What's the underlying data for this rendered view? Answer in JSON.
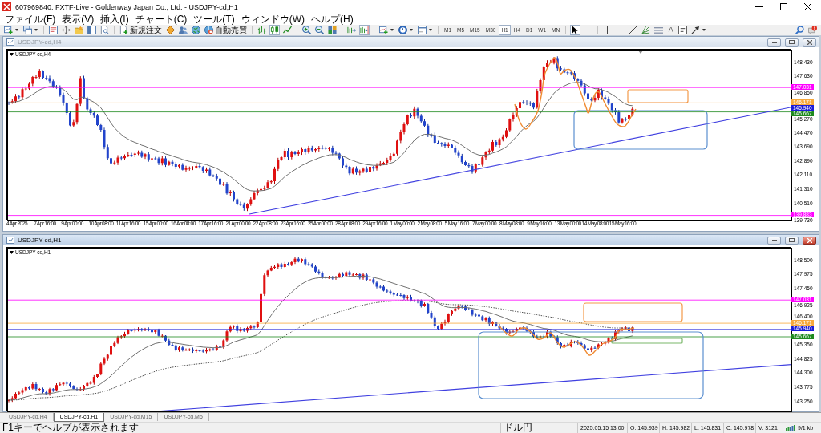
{
  "window": {
    "title": "607969840: FXTF-Live - Goldenway Japan Co., Ltd. - USDJPY-cd,H1"
  },
  "menu": [
    "ファイル(F)",
    "表示(V)",
    "挿入(I)",
    "チャート(C)",
    "ツール(T)",
    "ウィンドウ(W)",
    "ヘルプ(H)"
  ],
  "toolbar": {
    "new_order": "新規注文",
    "auto_trading": "自動売買",
    "chart_types": [
      {
        "kind": "bar",
        "selected": false
      },
      {
        "kind": "candle",
        "selected": true
      },
      {
        "kind": "line",
        "selected": false
      }
    ],
    "scroll": [
      {
        "kind": "shift",
        "on": false
      },
      {
        "kind": "autoscroll",
        "on": true
      }
    ],
    "timeframes": [
      {
        "label": "M1",
        "selected": false
      },
      {
        "label": "M5",
        "selected": false
      },
      {
        "label": "M15",
        "selected": false
      },
      {
        "label": "M30",
        "selected": false
      },
      {
        "label": "H1",
        "selected": true
      },
      {
        "label": "H4",
        "selected": false
      },
      {
        "label": "D1",
        "selected": false
      },
      {
        "label": "W1",
        "selected": false
      },
      {
        "label": "MN",
        "selected": false
      }
    ],
    "tools": [
      {
        "kind": "cursor",
        "selected": true
      },
      {
        "kind": "crosshair",
        "selected": false
      },
      {
        "kind": "vline",
        "selected": false
      },
      {
        "kind": "hline",
        "selected": false
      },
      {
        "kind": "trendline",
        "selected": false
      },
      {
        "kind": "fan",
        "selected": false
      },
      {
        "kind": "channel",
        "selected": false
      },
      {
        "kind": "text",
        "label": "A",
        "selected": false
      },
      {
        "kind": "label",
        "selected": false
      },
      {
        "kind": "arrows",
        "selected": false
      }
    ]
  },
  "charts": [
    {
      "title": "USDJPY-cd,H4",
      "active": false,
      "label": "USDJPY-cd,H4",
      "price_ticks": [
        "148.430",
        "147.630",
        "146.850",
        "145.270",
        "144.470",
        "143.690",
        "142.890",
        "142.110",
        "141.310",
        "140.510",
        "139.730"
      ],
      "price_tags": [
        {
          "text": "147.031",
          "color": "#ff00ff"
        },
        {
          "text": "146.171",
          "color": "#f7a83a"
        },
        {
          "text": "145.940",
          "color": "#1c1cd8"
        },
        {
          "text": "145.667",
          "color": "#1e8a1e"
        },
        {
          "text": "139.883",
          "color": "#ff00ff"
        }
      ],
      "time_ticks": [
        "4 Apr 2025",
        "7 Apr 16:00",
        "9 Apr 00:00",
        "10 Apr 08:00",
        "11 Apr 16:00",
        "15 Apr 00:00",
        "16 Apr 08:00",
        "17 Apr 16:00",
        "21 Apr 00:00",
        "22 Apr 08:00",
        "23 Apr 16:00",
        "25 Apr 00:00",
        "28 Apr 08:00",
        "29 Apr 16:00",
        "1 May 00:00",
        "2 May 08:00",
        "5 May 16:00",
        "7 May 00:00",
        "8 May 08:00",
        "9 May 16:00",
        "13 May 00:00",
        "14 May 08:00",
        "15 May 16:00"
      ]
    },
    {
      "title": "USDJPY-cd,H1",
      "active": true,
      "label": "USDJPY-cd,H1",
      "price_ticks": [
        "148.500",
        "147.975",
        "147.450",
        "146.925",
        "146.400",
        "145.350",
        "144.825",
        "144.300",
        "143.775",
        "143.250"
      ],
      "price_tags": [
        {
          "text": "147.031",
          "color": "#ff00ff"
        },
        {
          "text": "146.171",
          "color": "#f7a83a"
        },
        {
          "text": "145.940",
          "color": "#1c1cd8"
        },
        {
          "text": "145.667",
          "color": "#1e8a1e"
        }
      ]
    }
  ],
  "tabs": [
    {
      "label": "USDJPY-cd,H4",
      "selected": false
    },
    {
      "label": "USDJPY-cd,H1",
      "selected": true
    },
    {
      "label": "USDJPY-cd,M15",
      "selected": false
    },
    {
      "label": "USDJPY-cd,M5",
      "selected": false
    }
  ],
  "status_bar": {
    "help": "F1キーでヘルプが表示されます",
    "profile": "ドル円",
    "time": "2025.05.15 13:00",
    "open": "O: 145.939",
    "high": "H: 145.982",
    "low": "L: 145.831",
    "close": "C: 145.978",
    "volume": "V: 3121",
    "traffic": "9/1 kb"
  }
}
